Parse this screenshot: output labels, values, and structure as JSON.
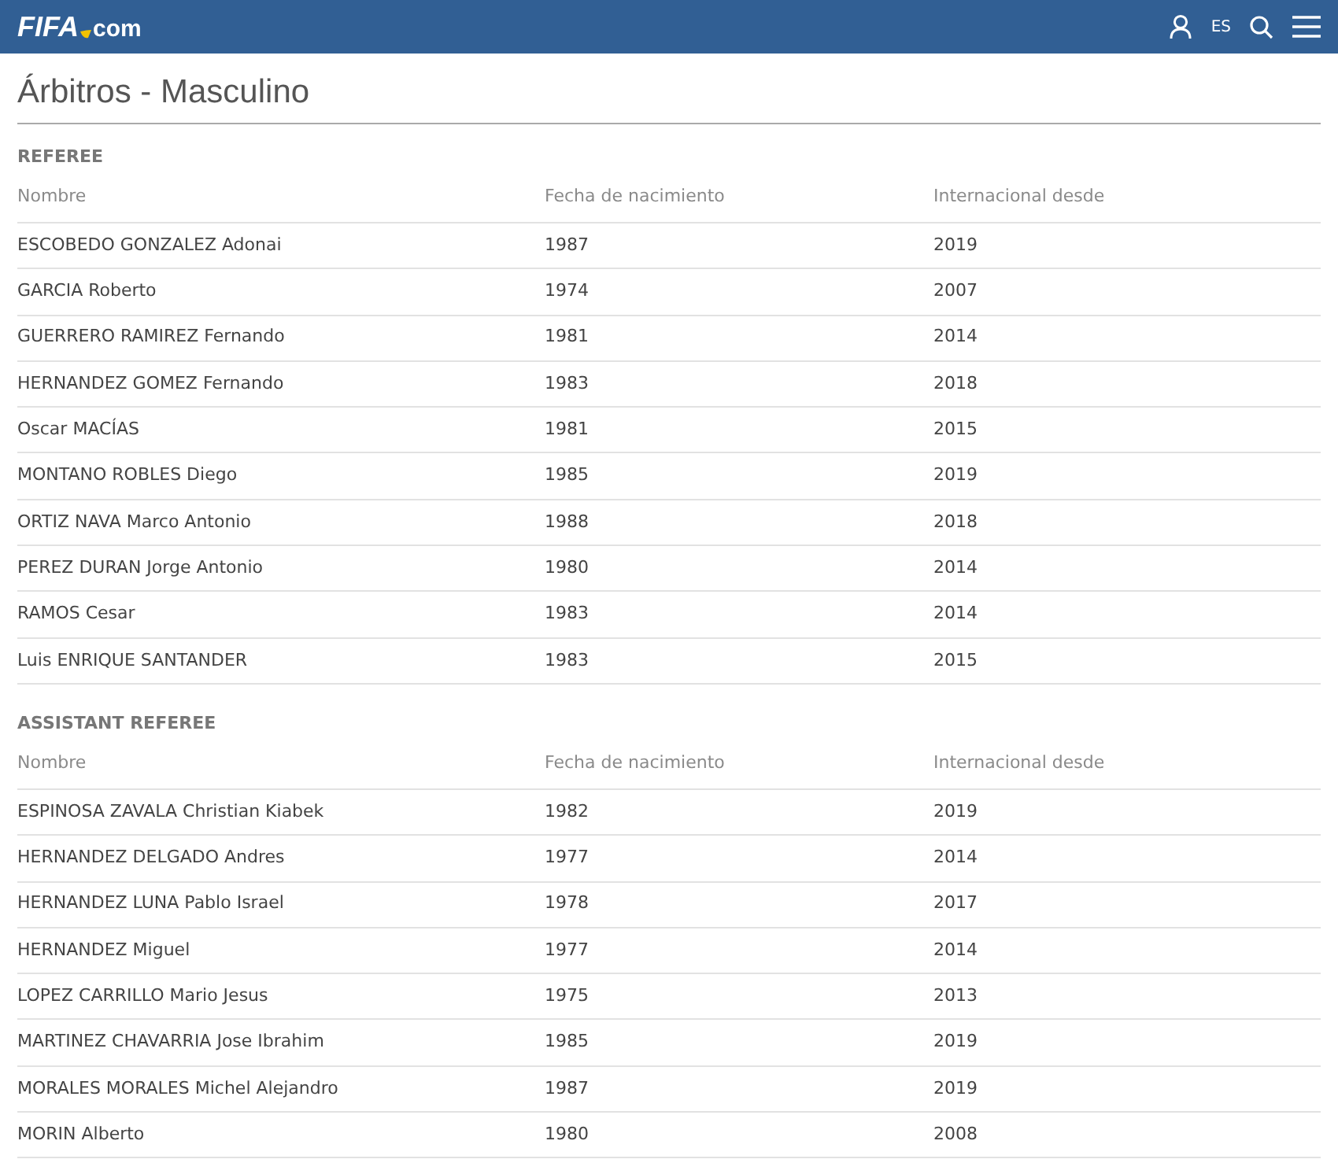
{
  "header": {
    "logo": {
      "main": "FIFA",
      "suffix": "com"
    },
    "language": "ES"
  },
  "title": "Árbitros - Masculino",
  "sections": [
    {
      "heading": "REFEREE",
      "columns": [
        "Nombre",
        "Fecha de nacimiento",
        "Internacional desde"
      ],
      "rows": [
        [
          "ESCOBEDO GONZALEZ Adonai",
          "1987",
          "2019"
        ],
        [
          "GARCIA Roberto",
          "1974",
          "2007"
        ],
        [
          "GUERRERO RAMIREZ Fernando",
          "1981",
          "2014"
        ],
        [
          "HERNANDEZ GOMEZ Fernando",
          "1983",
          "2018"
        ],
        [
          "Oscar MACÍAS",
          "1981",
          "2015"
        ],
        [
          "MONTANO ROBLES Diego",
          "1985",
          "2019"
        ],
        [
          "ORTIZ NAVA Marco Antonio",
          "1988",
          "2018"
        ],
        [
          "PEREZ DURAN Jorge Antonio",
          "1980",
          "2014"
        ],
        [
          "RAMOS Cesar",
          "1983",
          "2014"
        ],
        [
          "Luis ENRIQUE SANTANDER",
          "1983",
          "2015"
        ]
      ]
    },
    {
      "heading": "ASSISTANT REFEREE",
      "columns": [
        "Nombre",
        "Fecha de nacimiento",
        "Internacional desde"
      ],
      "rows": [
        [
          "ESPINOSA ZAVALA Christian Kiabek",
          "1982",
          "2019"
        ],
        [
          "HERNANDEZ DELGADO Andres",
          "1977",
          "2014"
        ],
        [
          "HERNANDEZ LUNA Pablo Israel",
          "1978",
          "2017"
        ],
        [
          "HERNANDEZ Miguel",
          "1977",
          "2014"
        ],
        [
          "LOPEZ CARRILLO Mario Jesus",
          "1975",
          "2013"
        ],
        [
          "MARTINEZ CHAVARRIA Jose Ibrahim",
          "1985",
          "2019"
        ],
        [
          "MORALES MORALES Michel Alejandro",
          "1987",
          "2019"
        ],
        [
          "MORIN Alberto",
          "1980",
          "2008"
        ]
      ]
    }
  ]
}
